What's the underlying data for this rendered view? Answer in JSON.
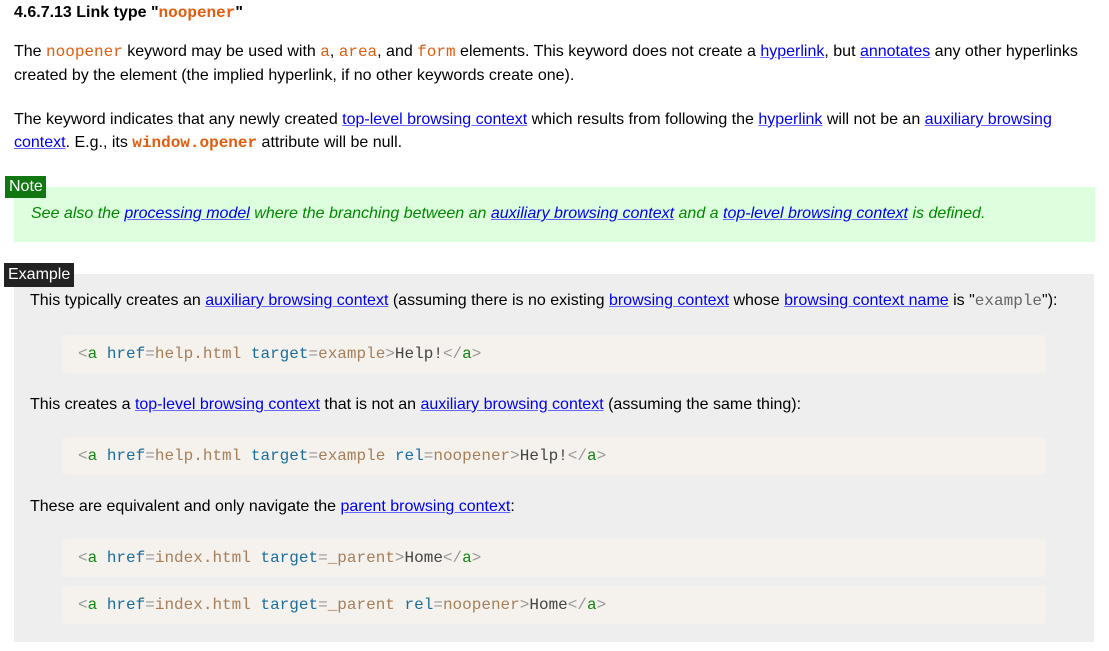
{
  "heading": {
    "prefix": "4.6.7.13 Link type \"",
    "keyword": "noopener",
    "suffix": "\""
  },
  "para1": {
    "t1": "The ",
    "kw": "noopener",
    "t2": " keyword may be used with ",
    "e1": "a",
    "t3": ", ",
    "e2": "area",
    "t4": ", and ",
    "e3": "form",
    "t5": " elements. This keyword does not create a ",
    "l1": "hyperlink",
    "t6": ", but ",
    "l2": "annotates",
    "t7": " any other hyperlinks created by the element (the implied hyperlink, if no other keywords create one)."
  },
  "para2": {
    "t1": "The keyword indicates that any newly created ",
    "l1": "top-level browsing context",
    "t2": " which results from following the ",
    "l2": "hyperlink",
    "t3": " will not be an ",
    "l3": "auxiliary browsing context",
    "t4": ". E.g., its ",
    "code": "window.opener",
    "t5": " attribute will be null."
  },
  "note": {
    "tag": "Note",
    "t1": "See also the ",
    "l1": "processing model",
    "t2": " where the branching between an ",
    "l2": "auxiliary browsing context",
    "t3": " and a ",
    "l3": "top-level browsing context",
    "t4": " is defined."
  },
  "example": {
    "tag": "Example",
    "line1": {
      "t1": "This typically creates an ",
      "l1": "auxiliary browsing context",
      "t2": " (assuming there is no existing ",
      "l2": "browsing context",
      "t3": " whose ",
      "l3": "browsing context name",
      "t4": " is \"",
      "code": "example",
      "t5": "\"):"
    },
    "line2": {
      "t1": "This creates a ",
      "l1": "top-level browsing context",
      "t2": " that is not an ",
      "l2": "auxiliary browsing context",
      "t3": " (assuming the same thing):"
    },
    "line3": {
      "t1": "These are equivalent and only navigate the ",
      "l1": "parent browsing context",
      "t2": ":"
    },
    "code1": {
      "open": "<",
      "tag": "a",
      "a1": "href",
      "eq1": "=",
      "v1": "help.html",
      "a2": "target",
      "eq2": "=",
      "v2": "example",
      "close": ">",
      "text": "Help!",
      "end_open": "</",
      "end_tag": "a",
      "end_close": ">"
    },
    "code2": {
      "open": "<",
      "tag": "a",
      "a1": "href",
      "eq1": "=",
      "v1": "help.html",
      "a2": "target",
      "eq2": "=",
      "v2": "example",
      "a3": "rel",
      "eq3": "=",
      "v3": "noopener",
      "close": ">",
      "text": "Help!",
      "end_open": "</",
      "end_tag": "a",
      "end_close": ">"
    },
    "code3": {
      "open": "<",
      "tag": "a",
      "a1": "href",
      "eq1": "=",
      "v1": "index.html",
      "a2": "target",
      "eq2": "=",
      "v2": "_parent",
      "close": ">",
      "text": "Home",
      "end_open": "</",
      "end_tag": "a",
      "end_close": ">"
    },
    "code4": {
      "open": "<",
      "tag": "a",
      "a1": "href",
      "eq1": "=",
      "v1": "index.html",
      "a2": "target",
      "eq2": "=",
      "v2": "_parent",
      "a3": "rel",
      "eq3": "=",
      "v3": "noopener",
      "close": ">",
      "text": "Home",
      "end_open": "</",
      "end_tag": "a",
      "end_close": ">"
    }
  }
}
